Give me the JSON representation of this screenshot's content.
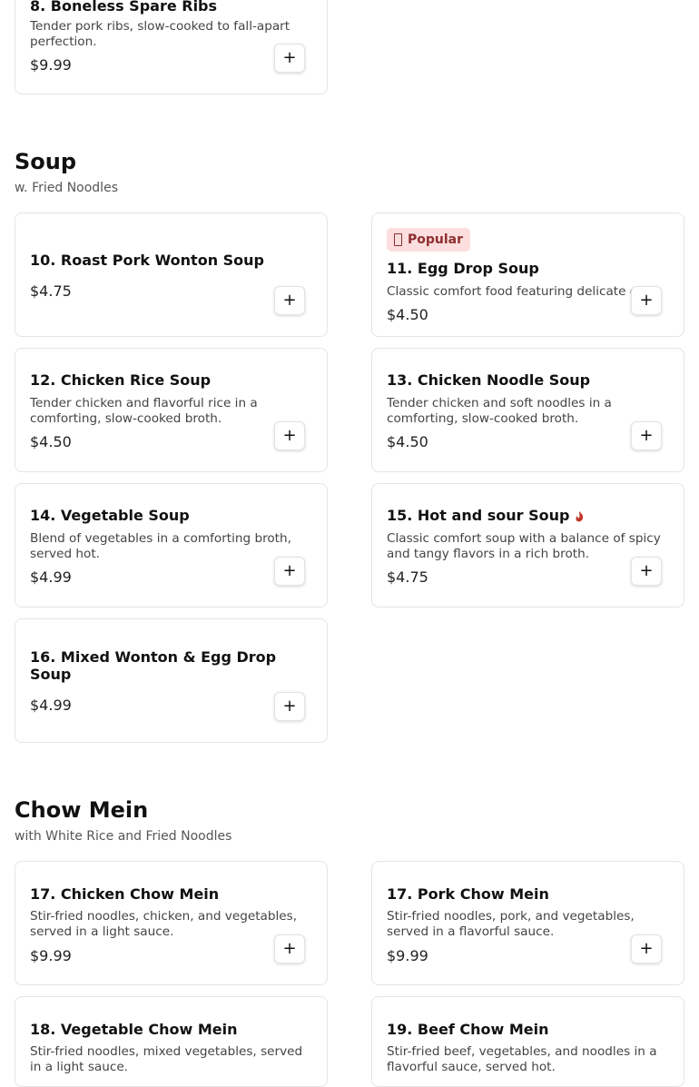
{
  "items": {
    "i8": {
      "title": "8. Boneless Spare Ribs",
      "description": "Tender pork ribs, slow-cooked to fall-apart perfection.",
      "price": "$9.99"
    },
    "i10": {
      "title": "10. Roast Pork Wonton Soup",
      "price": "$4.75"
    },
    "i11": {
      "badge": "Popular",
      "title": "11. Egg Drop Soup",
      "description": "Classic comfort food featuring delicate egg.",
      "price": "$4.50"
    },
    "i12": {
      "title": "12. Chicken Rice Soup",
      "description": "Tender chicken and flavorful rice in a comforting, slow-cooked broth.",
      "price": "$4.50"
    },
    "i13": {
      "title": "13. Chicken Noodle Soup",
      "description": "Tender chicken and soft noodles in a comforting, slow-cooked broth.",
      "price": "$4.50"
    },
    "i14": {
      "title": "14. Vegetable Soup",
      "description": "Blend of vegetables in a comforting broth, served hot.",
      "price": "$4.99"
    },
    "i15": {
      "title": "15. Hot and sour Soup",
      "description": "Classic comfort soup with a balance of spicy and tangy flavors in a rich broth.",
      "price": "$4.75",
      "icon": "chili-pepper-icon"
    },
    "i16": {
      "title": "16. Mixed Wonton & Egg Drop Soup",
      "price": "$4.99"
    },
    "i17": {
      "title": "17. Chicken Chow Mein",
      "description": "Stir-fried noodles, chicken, and vegetables, served in a light sauce.",
      "price": "$9.99"
    },
    "i17b": {
      "title": "17. Pork Chow Mein",
      "description": "Stir-fried noodles, pork, and vegetables, served in a flavorful sauce.",
      "price": "$9.99"
    },
    "i18": {
      "title": "18. Vegetable Chow Mein",
      "description": "Stir-fried noodles, mixed vegetables, served in a light sauce."
    },
    "i19": {
      "title": "19. Beef Chow Mein",
      "description": "Stir-fried beef, vegetables, and noodles in a flavorful sauce, served hot."
    }
  },
  "sections": {
    "soup": {
      "title": "Soup",
      "subtitle": "w. Fried Noodles"
    },
    "chow_mein": {
      "title": "Chow Mein",
      "subtitle": "with White Rice and Fried Noodles"
    }
  },
  "add_label": "+",
  "colors": {
    "badge_bg": "#fcdede",
    "badge_text": "#8e2e2e",
    "chili": "#c0392b"
  }
}
